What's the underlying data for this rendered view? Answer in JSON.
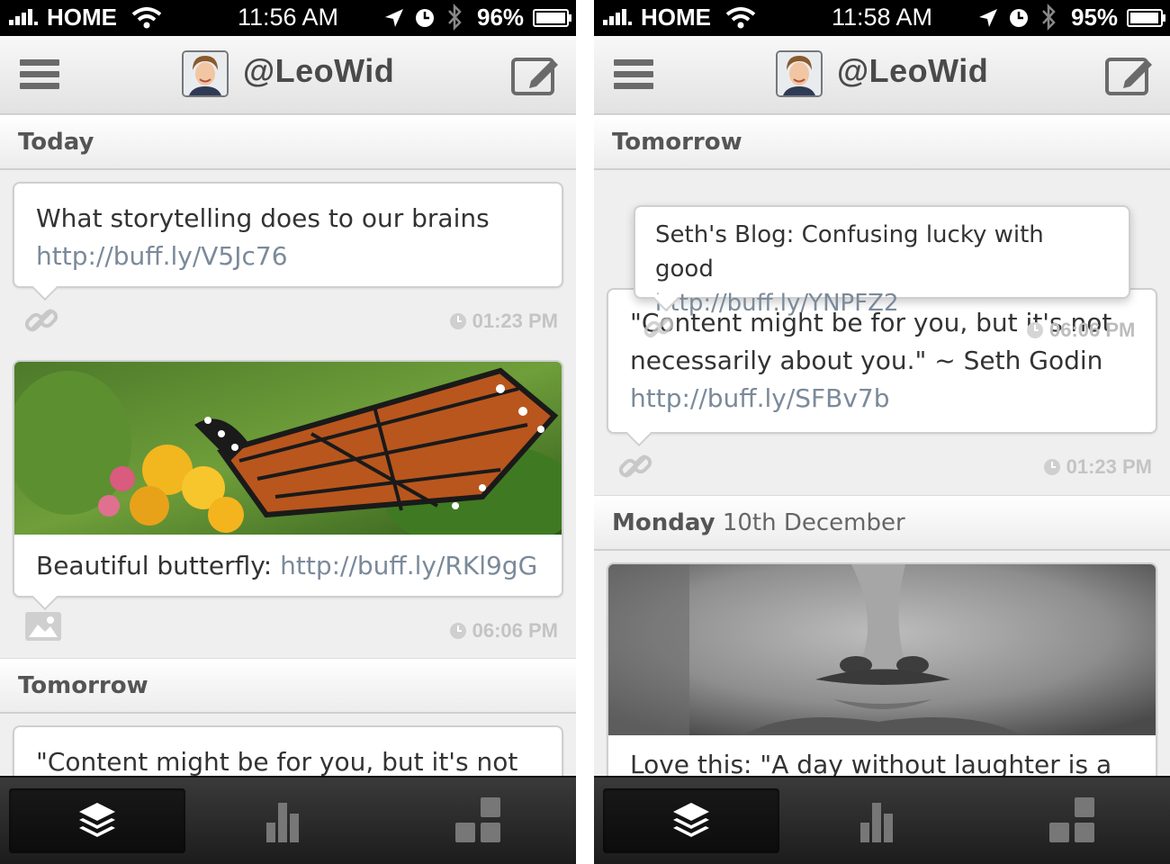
{
  "screens": [
    {
      "status_bar": {
        "carrier": "HOME",
        "time": "11:56 AM",
        "battery": "96%"
      },
      "nav": {
        "title": "@LeoWid",
        "menu_icon": "hamburger-menu-icon",
        "compose_icon": "compose-icon"
      },
      "sections": [
        {
          "day": "Today",
          "date": ""
        },
        {
          "day": "Tomorrow",
          "date": ""
        }
      ],
      "posts": [
        {
          "text": "What storytelling does to our brains",
          "link": "http://buff.ly/V5Jc76",
          "type_icon": "link-icon",
          "time": "01:23 PM"
        },
        {
          "text": "Beautiful butterfly: ",
          "link": "http://buff.ly/RKl9gG",
          "type_icon": "image-icon",
          "time": "06:06 PM",
          "image": "butterfly"
        },
        {
          "text": "\"Content might be for you, but it's not"
        }
      ],
      "tabs": [
        {
          "icon": "layers-icon",
          "active": true
        },
        {
          "icon": "analytics-bars-icon",
          "active": false
        },
        {
          "icon": "apps-blocks-icon",
          "active": false
        }
      ]
    },
    {
      "status_bar": {
        "carrier": "HOME",
        "time": "11:58 AM",
        "battery": "95%"
      },
      "nav": {
        "title": "@LeoWid",
        "menu_icon": "hamburger-menu-icon",
        "compose_icon": "compose-icon"
      },
      "sections": [
        {
          "day": "Tomorrow",
          "date": ""
        },
        {
          "day": "Monday",
          "date": " 10th December"
        }
      ],
      "posts": [
        {
          "text": "Seth's Blog: Confusing lucky with good",
          "link": "http://buff.ly/YNPFZ2",
          "time": "06:06 PM"
        },
        {
          "text": "\"Content might be for you, but it's not necessarily about you.\" ~ Seth Godin",
          "link": "http://buff.ly/SFBv7b",
          "type_icon": "link-icon",
          "time": "01:23 PM"
        },
        {
          "text": "Love this: \"A day without laughter is a",
          "image": "mustache-man"
        }
      ],
      "tabs": [
        {
          "icon": "layers-icon",
          "active": true
        },
        {
          "icon": "analytics-bars-icon",
          "active": false
        },
        {
          "icon": "apps-blocks-icon",
          "active": false
        }
      ]
    }
  ],
  "colors": {
    "link": "#7b8a9a",
    "text": "#333333",
    "meta": "#c4c4c4",
    "statusbar": "#000000"
  }
}
